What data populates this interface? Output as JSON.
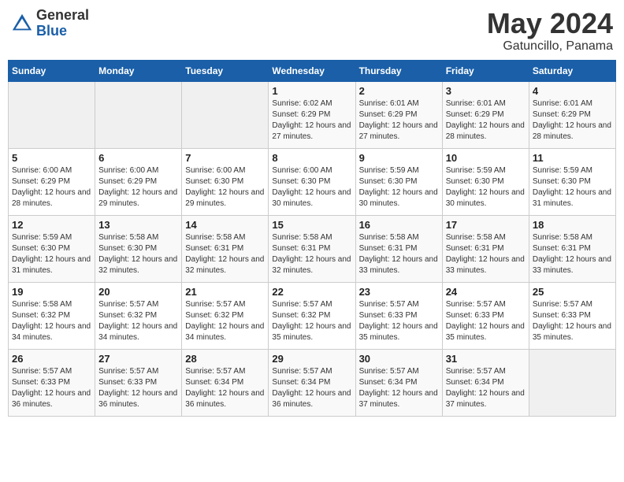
{
  "logo": {
    "general": "General",
    "blue": "Blue"
  },
  "header": {
    "month": "May 2024",
    "location": "Gatuncillo, Panama"
  },
  "days_of_week": [
    "Sunday",
    "Monday",
    "Tuesday",
    "Wednesday",
    "Thursday",
    "Friday",
    "Saturday"
  ],
  "weeks": [
    [
      {
        "day": "",
        "info": ""
      },
      {
        "day": "",
        "info": ""
      },
      {
        "day": "",
        "info": ""
      },
      {
        "day": "1",
        "info": "Sunrise: 6:02 AM\nSunset: 6:29 PM\nDaylight: 12 hours and 27 minutes."
      },
      {
        "day": "2",
        "info": "Sunrise: 6:01 AM\nSunset: 6:29 PM\nDaylight: 12 hours and 27 minutes."
      },
      {
        "day": "3",
        "info": "Sunrise: 6:01 AM\nSunset: 6:29 PM\nDaylight: 12 hours and 28 minutes."
      },
      {
        "day": "4",
        "info": "Sunrise: 6:01 AM\nSunset: 6:29 PM\nDaylight: 12 hours and 28 minutes."
      }
    ],
    [
      {
        "day": "5",
        "info": "Sunrise: 6:00 AM\nSunset: 6:29 PM\nDaylight: 12 hours and 28 minutes."
      },
      {
        "day": "6",
        "info": "Sunrise: 6:00 AM\nSunset: 6:29 PM\nDaylight: 12 hours and 29 minutes."
      },
      {
        "day": "7",
        "info": "Sunrise: 6:00 AM\nSunset: 6:30 PM\nDaylight: 12 hours and 29 minutes."
      },
      {
        "day": "8",
        "info": "Sunrise: 6:00 AM\nSunset: 6:30 PM\nDaylight: 12 hours and 30 minutes."
      },
      {
        "day": "9",
        "info": "Sunrise: 5:59 AM\nSunset: 6:30 PM\nDaylight: 12 hours and 30 minutes."
      },
      {
        "day": "10",
        "info": "Sunrise: 5:59 AM\nSunset: 6:30 PM\nDaylight: 12 hours and 30 minutes."
      },
      {
        "day": "11",
        "info": "Sunrise: 5:59 AM\nSunset: 6:30 PM\nDaylight: 12 hours and 31 minutes."
      }
    ],
    [
      {
        "day": "12",
        "info": "Sunrise: 5:59 AM\nSunset: 6:30 PM\nDaylight: 12 hours and 31 minutes."
      },
      {
        "day": "13",
        "info": "Sunrise: 5:58 AM\nSunset: 6:30 PM\nDaylight: 12 hours and 32 minutes."
      },
      {
        "day": "14",
        "info": "Sunrise: 5:58 AM\nSunset: 6:31 PM\nDaylight: 12 hours and 32 minutes."
      },
      {
        "day": "15",
        "info": "Sunrise: 5:58 AM\nSunset: 6:31 PM\nDaylight: 12 hours and 32 minutes."
      },
      {
        "day": "16",
        "info": "Sunrise: 5:58 AM\nSunset: 6:31 PM\nDaylight: 12 hours and 33 minutes."
      },
      {
        "day": "17",
        "info": "Sunrise: 5:58 AM\nSunset: 6:31 PM\nDaylight: 12 hours and 33 minutes."
      },
      {
        "day": "18",
        "info": "Sunrise: 5:58 AM\nSunset: 6:31 PM\nDaylight: 12 hours and 33 minutes."
      }
    ],
    [
      {
        "day": "19",
        "info": "Sunrise: 5:58 AM\nSunset: 6:32 PM\nDaylight: 12 hours and 34 minutes."
      },
      {
        "day": "20",
        "info": "Sunrise: 5:57 AM\nSunset: 6:32 PM\nDaylight: 12 hours and 34 minutes."
      },
      {
        "day": "21",
        "info": "Sunrise: 5:57 AM\nSunset: 6:32 PM\nDaylight: 12 hours and 34 minutes."
      },
      {
        "day": "22",
        "info": "Sunrise: 5:57 AM\nSunset: 6:32 PM\nDaylight: 12 hours and 35 minutes."
      },
      {
        "day": "23",
        "info": "Sunrise: 5:57 AM\nSunset: 6:33 PM\nDaylight: 12 hours and 35 minutes."
      },
      {
        "day": "24",
        "info": "Sunrise: 5:57 AM\nSunset: 6:33 PM\nDaylight: 12 hours and 35 minutes."
      },
      {
        "day": "25",
        "info": "Sunrise: 5:57 AM\nSunset: 6:33 PM\nDaylight: 12 hours and 35 minutes."
      }
    ],
    [
      {
        "day": "26",
        "info": "Sunrise: 5:57 AM\nSunset: 6:33 PM\nDaylight: 12 hours and 36 minutes."
      },
      {
        "day": "27",
        "info": "Sunrise: 5:57 AM\nSunset: 6:33 PM\nDaylight: 12 hours and 36 minutes."
      },
      {
        "day": "28",
        "info": "Sunrise: 5:57 AM\nSunset: 6:34 PM\nDaylight: 12 hours and 36 minutes."
      },
      {
        "day": "29",
        "info": "Sunrise: 5:57 AM\nSunset: 6:34 PM\nDaylight: 12 hours and 36 minutes."
      },
      {
        "day": "30",
        "info": "Sunrise: 5:57 AM\nSunset: 6:34 PM\nDaylight: 12 hours and 37 minutes."
      },
      {
        "day": "31",
        "info": "Sunrise: 5:57 AM\nSunset: 6:34 PM\nDaylight: 12 hours and 37 minutes."
      },
      {
        "day": "",
        "info": ""
      }
    ]
  ]
}
